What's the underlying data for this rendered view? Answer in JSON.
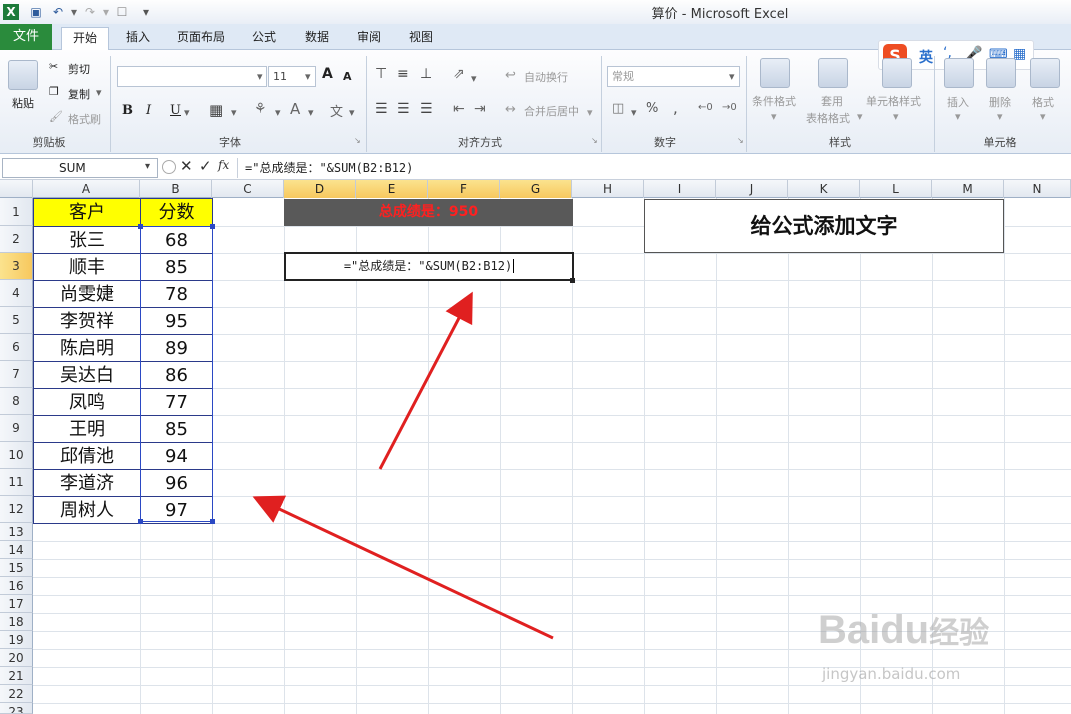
{
  "window": {
    "title": "算价 - Microsoft Excel"
  },
  "tabs": [
    "文件",
    "开始",
    "插入",
    "页面布局",
    "公式",
    "数据",
    "审阅",
    "视图"
  ],
  "ribbon": {
    "clipboard": {
      "paste": "粘贴",
      "cut": "剪切",
      "copy": "复制",
      "format_painter": "格式刷",
      "label": "剪贴板"
    },
    "font": {
      "size": "11",
      "bold": "B",
      "italic": "I",
      "underline": "U",
      "grow": "A",
      "shrink": "A",
      "label": "字体"
    },
    "alignment": {
      "wrap": "自动换行",
      "merge": "合并后居中",
      "label": "对齐方式"
    },
    "number": {
      "format": "常规",
      "percent": "%",
      "comma": ",",
      "label": "数字"
    },
    "styles": {
      "conditional": "条件格式",
      "table_1": "套用",
      "table_2": "表格格式",
      "cell_style": "单元格样式",
      "label": "样式"
    },
    "cells": {
      "insert": "插入",
      "delete": "删除",
      "format": "格式",
      "label": "单元格"
    }
  },
  "ime": {
    "logo": "S",
    "lang": "英"
  },
  "formula_bar": {
    "name_box": "SUM",
    "fx": "fx",
    "formula": "=\"总成绩是：\"&SUM(B2:B12)"
  },
  "columns": [
    "A",
    "B",
    "C",
    "D",
    "E",
    "F",
    "G",
    "H",
    "I",
    "J",
    "K",
    "L",
    "M",
    "N"
  ],
  "rows": [
    "1",
    "2",
    "3",
    "4",
    "5",
    "6",
    "7",
    "8",
    "9",
    "10",
    "11",
    "12",
    "13",
    "14",
    "15",
    "16",
    "17",
    "18",
    "19",
    "20",
    "21",
    "22",
    "23"
  ],
  "sheet": {
    "header": {
      "name": "客户",
      "score": "分数"
    },
    "records": [
      {
        "name": "张三",
        "score": "68"
      },
      {
        "name": "顺丰",
        "score": "85"
      },
      {
        "name": "尚雯婕",
        "score": "78"
      },
      {
        "name": "李贺祥",
        "score": "95"
      },
      {
        "name": "陈启明",
        "score": "89"
      },
      {
        "name": "吴达白",
        "score": "86"
      },
      {
        "name": "凤鸣",
        "score": "77"
      },
      {
        "name": "王明",
        "score": "85"
      },
      {
        "name": "邱倩池",
        "score": "94"
      },
      {
        "name": "李道济",
        "score": "96"
      },
      {
        "name": "周树人",
        "score": "97"
      }
    ],
    "total_banner": "总成绩是：950",
    "editing_cell": "=\"总成绩是：\"&SUM(B2:B12)",
    "note_box": "给公式添加文字"
  },
  "watermark": {
    "brand": "Baidu",
    "suffix": "经验",
    "url": "jingyan.baidu.com"
  },
  "colors": {
    "file_tab": "#2a8b3c",
    "header_fill": "#ffff00",
    "banner_fill": "#595959",
    "banner_text": "#ff2020",
    "arrow": "#e02020"
  }
}
